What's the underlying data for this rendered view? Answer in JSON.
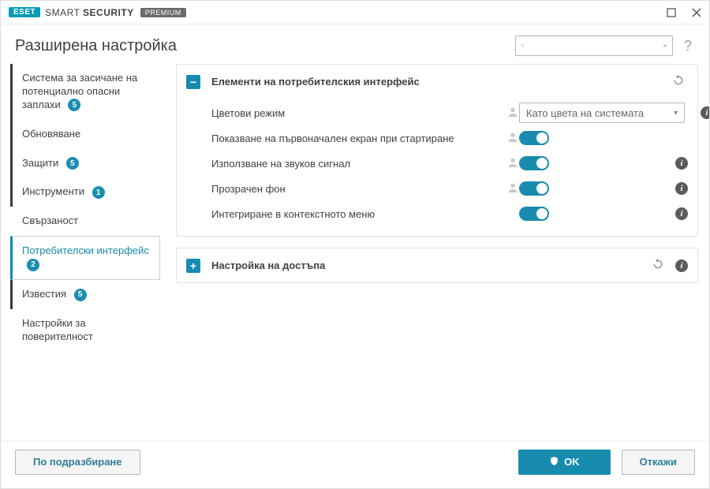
{
  "brand": {
    "eset": "ESET",
    "smart": "SMART",
    "security": "SECURITY",
    "edition": "PREMIUM"
  },
  "header": {
    "title": "Разширена настройка",
    "search_placeholder": ""
  },
  "sidebar": {
    "items": [
      {
        "label": "Система за засичане на потенциално опасни заплахи",
        "badge": "5"
      },
      {
        "label": "Обновяване"
      },
      {
        "label": "Защити",
        "badge": "5"
      },
      {
        "label": "Инструменти",
        "badge": "1"
      },
      {
        "label": "Свързаност"
      },
      {
        "label": "Потребителски интерфейс",
        "badge": "2"
      },
      {
        "label": "Известия",
        "badge": "5"
      },
      {
        "label": "Настройки за поверителност"
      }
    ]
  },
  "panel_ui": {
    "title": "Елементи на потребителския интерфейс",
    "rows": {
      "color_mode": {
        "label": "Цветови режим",
        "value": "Като цвета на системата"
      },
      "splash": {
        "label": "Показване на първоначален екран при стартиране"
      },
      "sound": {
        "label": "Използване на звуков сигнал"
      },
      "transparent": {
        "label": "Прозрачен фон"
      },
      "context": {
        "label": "Интегриране в контекстното меню"
      }
    }
  },
  "panel_access": {
    "title": "Настройка на достъпа"
  },
  "footer": {
    "default": "По подразбиране",
    "ok": "OK",
    "cancel": "Откажи"
  }
}
